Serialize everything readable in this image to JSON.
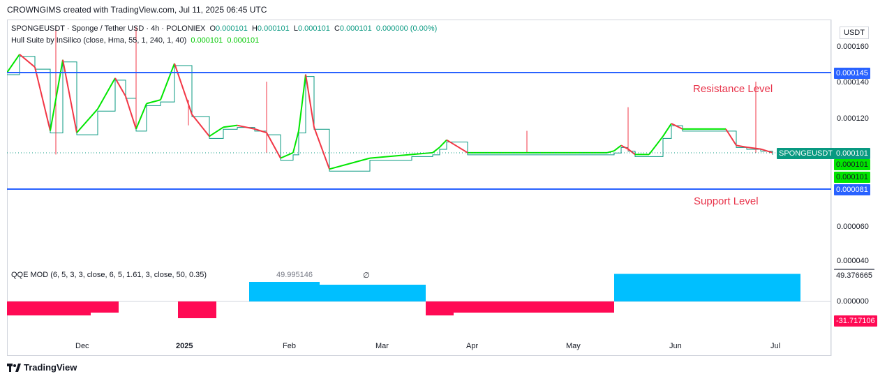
{
  "header": {
    "credit": "CROWNGIMS created with TradingView.com, Jul 11, 2025 06:45 UTC"
  },
  "legend": {
    "symbol_line": "SPONGEUSDT · Sponge / Tether USD · 4h · POLONIEX",
    "o_label": "O",
    "o_value": "0.000101",
    "h_label": "H",
    "h_value": "0.000101",
    "l_label": "L",
    "l_value": "0.000101",
    "c_label": "C",
    "c_value": "0.000101",
    "change": "0.000000 (0.00%)",
    "hull_label": "Hull Suite by InSilico (close, Hma, 55, 1, 240, 1, 40)",
    "hull_value_1": "0.000101",
    "hull_value_2": "0.000101"
  },
  "qqe_legend": {
    "label": "QQE MOD (6, 5, 3, 3, close, 6, 5, 1.61, 3, close, 50, 0.35)",
    "value": "49.995146",
    "symbol": "∅"
  },
  "annotations": {
    "resistance": "Resistance Level",
    "support": "Support Level"
  },
  "price_axis": {
    "currency": "USDT",
    "ticks": [
      "0.000160",
      "0.000140",
      "0.000120",
      "0.000060",
      "0.000040"
    ]
  },
  "price_tags": {
    "resistance": "0.000145",
    "symbol_name": "SPONGEUSDT",
    "last": "0.000101",
    "hull1": "0.000101",
    "hull2": "0.000101",
    "support": "0.000081"
  },
  "osc_axis": {
    "ticks": [
      "0.000000"
    ],
    "tag_positive": "49.376665",
    "tag_negative": "-31.717106"
  },
  "time_axis": [
    "Dec",
    "2025",
    "Feb",
    "Mar",
    "Apr",
    "May",
    "Jun",
    "Jul"
  ],
  "brand": "TradingView",
  "colors": {
    "bull": "#00e600",
    "bear": "#f23645",
    "level_line": "#2962ff",
    "qqe_up": "#00bfff",
    "qqe_down": "#ff0a54",
    "qqe_neutral": "#787b86",
    "last_price": "#089981",
    "hull_tag": "#00e600"
  },
  "chart_data": {
    "type": "line",
    "title": "SPONGEUSDT · Sponge / Tether USD · 4h · POLONIEX",
    "x_labels": [
      "Dec",
      "2025",
      "Feb",
      "Mar",
      "Apr",
      "May",
      "Jun",
      "Jul"
    ],
    "y_range": [
      4e-05,
      0.00017
    ],
    "levels": [
      {
        "name": "Resistance Level",
        "value": 0.000145
      },
      {
        "name": "Support Level",
        "value": 8.1e-05
      }
    ],
    "series": [
      {
        "name": "Hull Suite by InSilico (close, Hma, 55, 1, 240, 1, 40)",
        "x": [
          "Nov 18",
          "Nov 21",
          "Nov 24",
          "Nov 27",
          "Nov 30",
          "Dec 3",
          "Dec 6",
          "Dec 9",
          "Dec 12",
          "Dec 15",
          "Dec 18",
          "Dec 22",
          "Dec 26",
          "Dec 30",
          "Jan 3",
          "Jan 8",
          "Jan 12",
          "Jan 16",
          "Jan 20",
          "Jan 24",
          "Jan 28",
          "Jan 31",
          "Feb 2",
          "Feb 5",
          "Feb 10",
          "Feb 20",
          "Mar 5",
          "Mar 12",
          "Mar 18",
          "Mar 22",
          "Mar 28",
          "Apr 2",
          "Apr 15",
          "Apr 25",
          "May 5",
          "May 10",
          "May 14",
          "May 16",
          "May 18",
          "May 22",
          "May 26",
          "May 29",
          "Jun 2",
          "Jun 10",
          "Jun 16",
          "Jun 19",
          "Jun 23",
          "Jun 26",
          "Jun 28"
        ],
        "y": [
          0.000145,
          0.000155,
          0.000148,
          0.000113,
          0.000152,
          0.000112,
          0.000125,
          0.000142,
          0.000132,
          0.000114,
          0.000128,
          0.00013,
          0.00015,
          0.000122,
          0.00011,
          0.000115,
          0.000116,
          0.000114,
          0.000112,
          9.8e-05,
          0.000101,
          0.000113,
          0.000144,
          0.000115,
          9.2e-05,
          9.8e-05,
          0.0001,
          0.000101,
          0.000104,
          0.000108,
          0.000101,
          0.000101,
          0.000101,
          0.000101,
          0.000101,
          0.000102,
          0.000105,
          0.000103,
          0.0001,
          0.0001,
          0.00011,
          0.000117,
          0.000114,
          0.000114,
          0.000114,
          0.000105,
          0.000104,
          0.000103,
          0.000101
        ]
      },
      {
        "name": "QQE MOD",
        "x": [
          "Nov",
          "Dec",
          "2025",
          "Feb",
          "Mar",
          "Apr",
          "May",
          "Jun",
          "Jul"
        ],
        "y": [
          -25,
          -20,
          -30,
          35,
          30,
          -25,
          -20,
          -20,
          49.38
        ]
      }
    ]
  }
}
